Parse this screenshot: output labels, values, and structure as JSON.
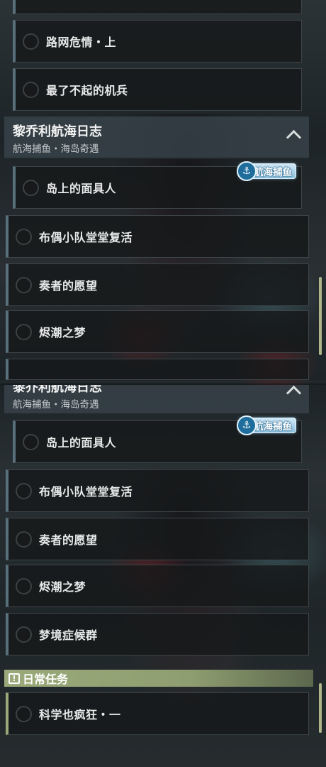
{
  "top_quests": [
    {
      "label": "路网危情・上"
    },
    {
      "label": "最了不起的机兵"
    }
  ],
  "group_upper": {
    "title": "黎乔利航海日志",
    "subtitle": "航海捕鱼・海岛奇遇",
    "badge": "航海捕鱼",
    "quests": [
      {
        "label": "岛上的面具人"
      },
      {
        "label": "布偶小队堂堂复活"
      },
      {
        "label": "奏者的愿望"
      },
      {
        "label": "烬潮之梦"
      }
    ]
  },
  "group_lower": {
    "title": "黎乔利航海日志",
    "subtitle": "航海捕鱼・海岛奇遇",
    "badge": "航海捕鱼",
    "quests": [
      {
        "label": "岛上的面具人"
      },
      {
        "label": "布偶小队堂堂复活"
      },
      {
        "label": "奏者的愿望"
      },
      {
        "label": "烬潮之梦"
      },
      {
        "label": "梦境症候群"
      }
    ]
  },
  "daily": {
    "title": "日常任务",
    "quests": [
      {
        "label": "科学也疯狂・一"
      }
    ]
  },
  "icons": {
    "collapse": "chevron-up-icon",
    "badge": "anchor-icon",
    "daily": "exclamation-icon"
  },
  "colors": {
    "accent_bar": "#586f7c",
    "daily_header": "#9aa97a",
    "badge": "#8ec1df"
  }
}
